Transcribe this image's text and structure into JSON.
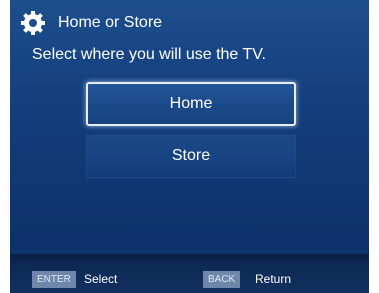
{
  "header": {
    "icon": "gear-icon",
    "title": "Home or Store"
  },
  "prompt": "Select where you will use the TV.",
  "options": [
    {
      "label": "Home",
      "selected": true
    },
    {
      "label": "Store",
      "selected": false
    }
  ],
  "footer": {
    "enter_key": "ENTER",
    "enter_label": "Select",
    "back_key": "BACK",
    "back_label": "Return"
  },
  "colors": {
    "background": "#123c78",
    "highlight_border": "#e9eef6",
    "key_badge": "#6f87aa",
    "text": "#ffffff"
  }
}
